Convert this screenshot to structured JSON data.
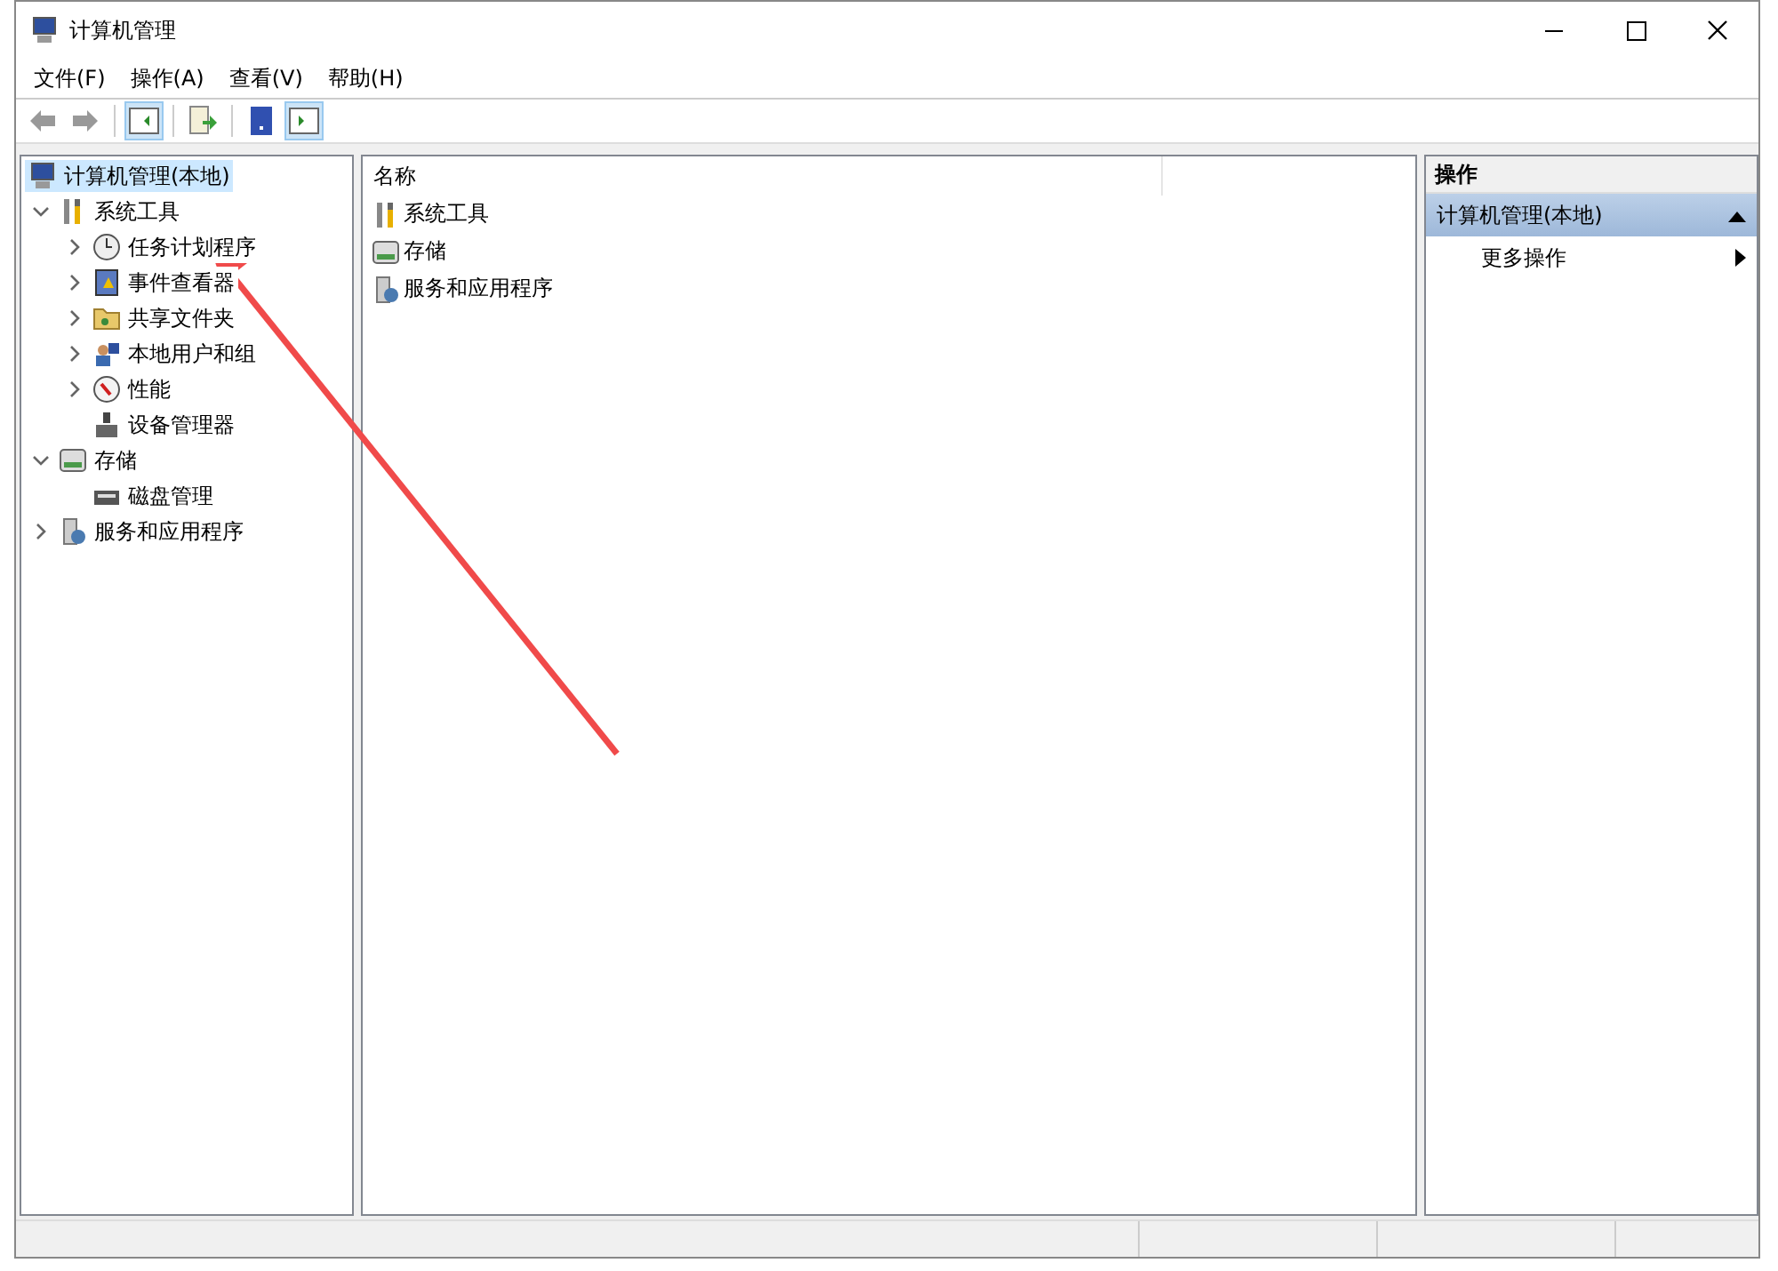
{
  "window": {
    "title": "计算机管理"
  },
  "menu": [
    "文件(F)",
    "操作(A)",
    "查看(V)",
    "帮助(H)"
  ],
  "toolbar": [
    {
      "kind": "back",
      "selected": false
    },
    {
      "kind": "forward",
      "selected": false
    },
    {
      "kind": "tree",
      "selected": true
    },
    {
      "kind": "export",
      "selected": false
    },
    {
      "kind": "help",
      "selected": false
    },
    {
      "kind": "pane",
      "selected": true
    }
  ],
  "tree": [
    {
      "label": "计算机管理(本地)",
      "kind": "computer",
      "selected": true,
      "children": [
        {
          "label": "系统工具",
          "kind": "tools",
          "selected": false,
          "expanded": true,
          "children": [
            {
              "label": "任务计划程序",
              "kind": "clock",
              "selected": false,
              "expanded": false
            },
            {
              "label": "事件查看器",
              "kind": "log",
              "selected": false,
              "expanded": false
            },
            {
              "label": "共享文件夹",
              "kind": "folder",
              "selected": false,
              "expanded": false
            },
            {
              "label": "本地用户和组",
              "kind": "users",
              "selected": false,
              "expanded": false
            },
            {
              "label": "性能",
              "kind": "gauge",
              "selected": false,
              "expanded": false
            },
            {
              "label": "设备管理器",
              "kind": "device",
              "selected": false
            }
          ]
        },
        {
          "label": "存储",
          "kind": "storage",
          "selected": false,
          "expanded": true,
          "children": [
            {
              "label": "磁盘管理",
              "kind": "disk",
              "selected": false
            }
          ]
        },
        {
          "label": "服务和应用程序",
          "kind": "services",
          "selected": false,
          "expanded": false
        }
      ]
    }
  ],
  "list": {
    "column": "名称",
    "items": [
      {
        "label": "系统工具",
        "kind": "tools"
      },
      {
        "label": "存储",
        "kind": "storage"
      },
      {
        "label": "服务和应用程序",
        "kind": "services"
      }
    ]
  },
  "actions": {
    "title": "操作",
    "section": "计算机管理(本地)",
    "items": [
      "更多操作"
    ]
  }
}
